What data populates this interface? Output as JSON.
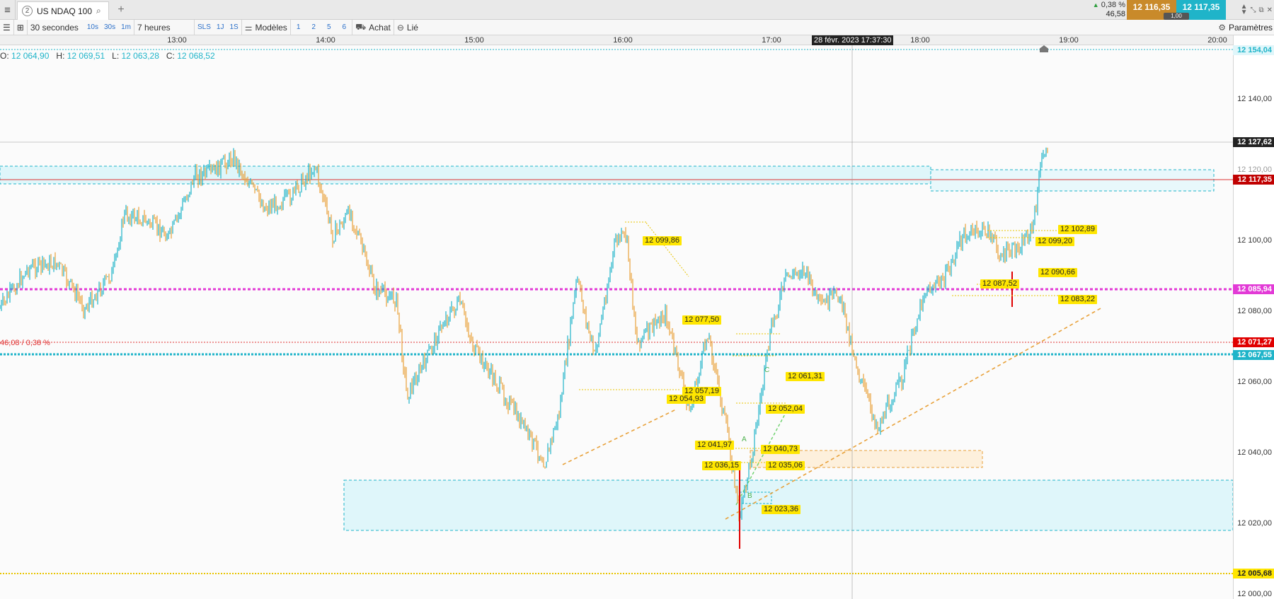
{
  "tabbar": {
    "tab_number": "2",
    "tab_title": "US NDAQ 100",
    "change_percent": "0,38 %",
    "change_value": "46,58",
    "bid": "12 116,35",
    "ask": "12 117,35",
    "spread": "1,00"
  },
  "toolbar": {
    "interval": "30 secondes",
    "quick_intervals": [
      "10s",
      "30s",
      "1m"
    ],
    "range": "7 heures",
    "range_buttons": [
      "SLS",
      "1J",
      "1S"
    ],
    "models_label": "Modèles",
    "layout_buttons": [
      "1",
      "2",
      "5",
      "6"
    ],
    "buy_label": "Achat",
    "link_label": "Lié",
    "settings_label": "Paramètres"
  },
  "time_axis": {
    "labels": [
      "13:00",
      "14:00",
      "15:00",
      "16:00",
      "17:00",
      "18:00",
      "19:00",
      "20:00"
    ],
    "cursor_label": "28 févr. 2023 17:37:30"
  },
  "ohlc": {
    "o_label": "O:",
    "o": "12 064,90",
    "h_label": "H:",
    "h": "12 069,51",
    "l_label": "L:",
    "l": "12 063,28",
    "c_label": "C:",
    "c": "12 068,52"
  },
  "price_axis": {
    "labels": [
      "12 140,00",
      "12 120,00",
      "12 100,00",
      "12 080,00",
      "12 060,00",
      "12 040,00",
      "12 020,00",
      "12 000,00"
    ],
    "tags": {
      "top": "12 154,04",
      "cursor": "12 127,62",
      "last": "12 117,35",
      "magenta": "12 085,94",
      "red_dotted": "12 071,27",
      "cyan": "12 067,55",
      "yellow": "12 005,68"
    }
  },
  "left_marker": "46,08 / 0,38 %",
  "annotations": [
    "12 099,86",
    "12 077,50",
    "12 057,19",
    "12 054,93",
    "12 041,97",
    "12 036,15",
    "12 061,31",
    "12 052,04",
    "12 040,73",
    "12 035,06",
    "12 023,36",
    "12 102,89",
    "12 099,20",
    "12 090,66",
    "12 087,52",
    "12 083,22"
  ],
  "colors": {
    "bull": "#1fb4c9",
    "bear": "#e8a13a",
    "last_price_red": "#c00000",
    "magenta": "#e23ad6",
    "cyan_line": "#1fb4c9",
    "yellow_label": "#ffe600",
    "zone_fill": "#dff6fa"
  }
}
